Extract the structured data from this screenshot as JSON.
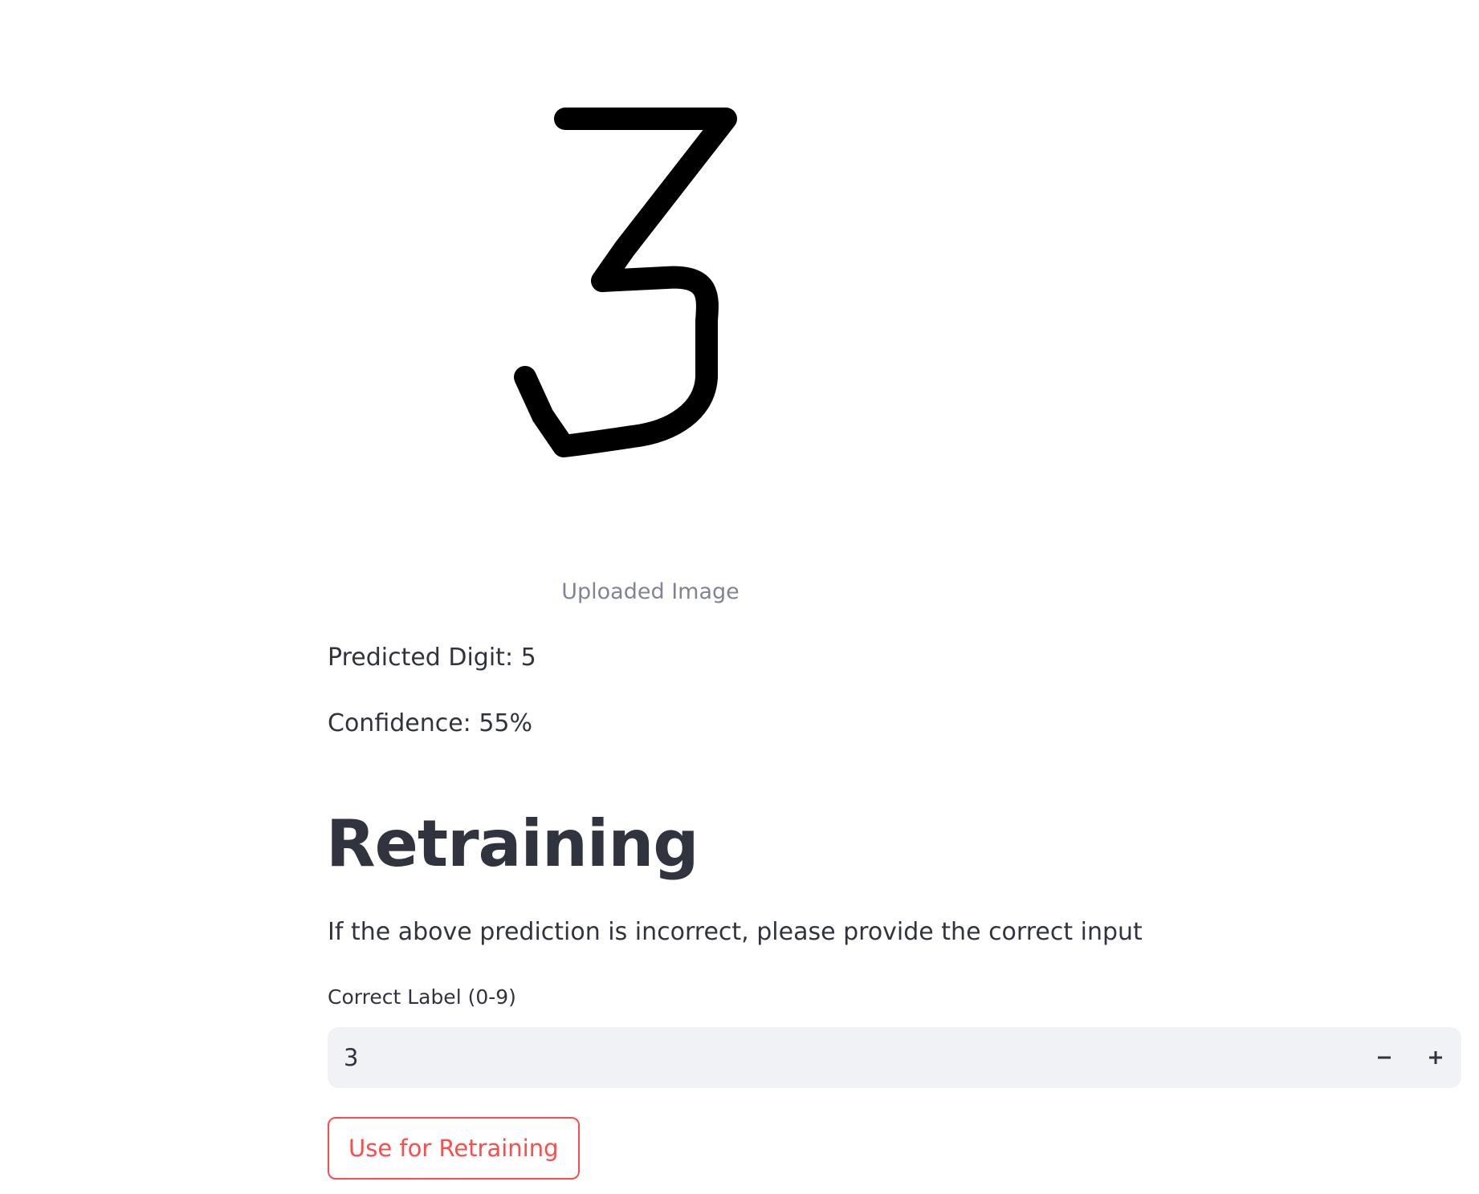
{
  "uploaded_image": {
    "caption": "Uploaded Image",
    "depicts": "handwritten digit 3"
  },
  "prediction": {
    "predicted_text": "Predicted Digit: 5",
    "confidence_text": "Confidence: 55%"
  },
  "retraining": {
    "heading": "Retraining",
    "instruction": "If the above prediction is incorrect, please provide the correct input",
    "label_field": {
      "label": "Correct Label (0-9)",
      "value": "3",
      "decrement_icon": "minus-icon",
      "increment_icon": "plus-icon"
    },
    "button_label": "Use for Retraining"
  },
  "colors": {
    "text": "#31333f",
    "caption": "#808495",
    "input_background": "#f0f2f6",
    "accent": "#ff4b4b"
  }
}
